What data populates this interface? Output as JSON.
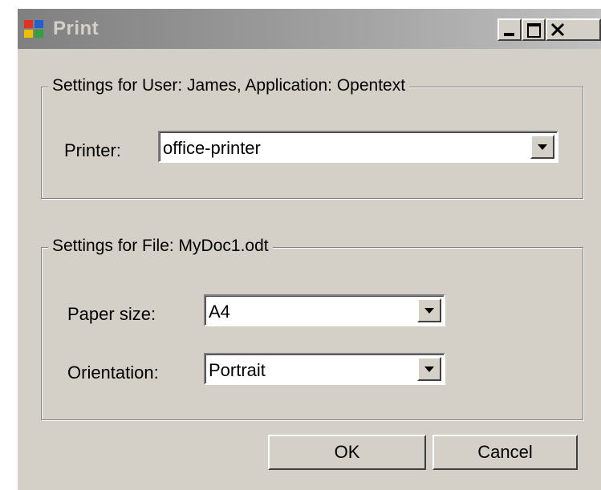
{
  "window": {
    "title": "Print",
    "icon": "app-window-icon",
    "caption_buttons": [
      "minimize-icon",
      "maximize-icon",
      "close-icon"
    ]
  },
  "user_settings": {
    "legend": "Settings for User: James, Application: Opentext",
    "printer_label": "Printer:",
    "printer_value": "office-printer"
  },
  "file_settings": {
    "legend": "Settings for File: MyDoc1.odt",
    "paper_size_label": "Paper size:",
    "paper_size_value": "A4",
    "orientation_label": "Orientation:",
    "orientation_value": "Portrait"
  },
  "buttons": {
    "ok": "OK",
    "cancel": "Cancel"
  }
}
